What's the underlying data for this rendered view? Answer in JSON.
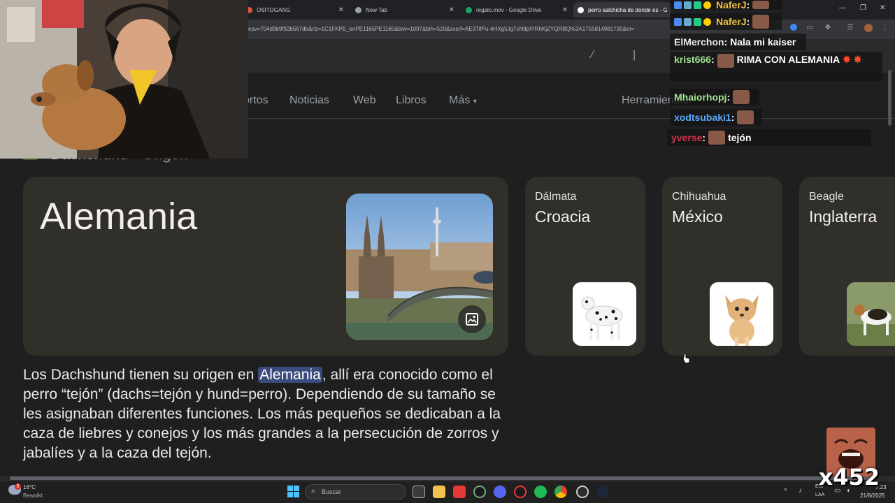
{
  "browser": {
    "tabs": [
      {
        "label": "OSITOGANG",
        "icon": "fire-icon"
      },
      {
        "label": "New Tab",
        "icon": "globe-icon"
      },
      {
        "label": "regalo.mov - Google Drive",
        "icon": "drive-icon"
      },
      {
        "label": "perro salchicha de donde es - G",
        "icon": "google-icon"
      }
    ],
    "url": "esv=704d9b9f92b567db&rlz=1C1FKPE_enPE1165PE1165&biw=1097&bih=520&sxsrf=AE3TifPu-4HXg5Jg7cNtIpIYRhKjZYQRBQ%3A1755814981730&ei="
  },
  "search_nav": {
    "items": [
      "ortos",
      "Noticias",
      "Web",
      "Libros",
      "Más"
    ],
    "tools": "Herramientas"
  },
  "breadcrumb": {
    "breed": "Dachshund",
    "sep": " › ",
    "field": "Origen"
  },
  "main_card": {
    "title": "Alemania",
    "image_icon": "image-icon"
  },
  "related": [
    {
      "breed": "Dálmata",
      "country": "Croacia",
      "colors": "#ffffff"
    },
    {
      "breed": "Chihuahua",
      "country": "México",
      "colors": "#ffffff"
    },
    {
      "breed": "Beagle",
      "country": "Inglaterra",
      "colors": "#ffffff"
    }
  ],
  "description": {
    "before": "Los Dachshund tienen su origen en ",
    "highlight": "Alemania",
    "after": ", allí era conocido como el perro “tejón” (dachs=tejón y hund=perro). Dependiendo de su tamaño se les asignaban diferentes funciones. Los más pequeños se dedicaban a la caza de liebres y conejos y los más grandes a la persecución de zorros y jabalíes y a la caza del tejón."
  },
  "chat": [
    {
      "user": "NaferJ",
      "sep": " :",
      "msg": "",
      "color": "#f0c040"
    },
    {
      "user": "NaferJ",
      "sep": " :",
      "msg": "",
      "color": "#f0c040"
    },
    {
      "user": "ElMerchon",
      "sep": " :",
      "msg": "Nala mi kaiser",
      "color": "#e8e8e8"
    },
    {
      "user": "krist666",
      "sep": " :",
      "msg": "RIMA CON ALEMANIA",
      "color": "#9fe38f"
    },
    {
      "user": "Mhaiorhopj",
      "sep": " :",
      "msg": "",
      "color": "#9fe38f"
    },
    {
      "user": "xodtsubaki1",
      "sep": " :",
      "msg": "",
      "color": "#5aa8ff"
    },
    {
      "user": "yverse",
      "sep": " :",
      "msg": "tejón",
      "color": "#d9304b"
    }
  ],
  "taskbar": {
    "weather_temp": "16°C",
    "weather_desc": "Bewolkt",
    "search_placeholder": "Buscar",
    "lang1": "ESP",
    "lang2": "LAA",
    "time": "7:23",
    "date": "21/8/2025",
    "weather_badge": "5"
  },
  "overlay": {
    "counter": "x452"
  },
  "colors": {
    "accent": "#3b4b7d",
    "card": "#302f2a",
    "bg": "#1f1f1f"
  }
}
